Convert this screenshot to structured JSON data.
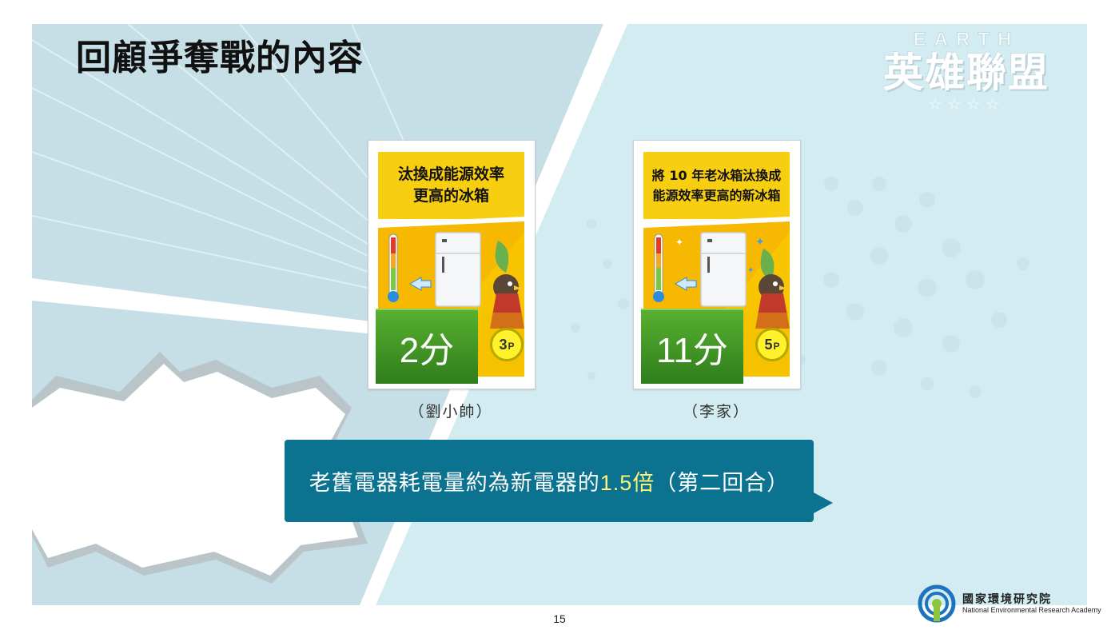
{
  "slide": {
    "title": "回顧爭奪戰的內容",
    "logo": {
      "top": "EARTH",
      "main": "英雄聯盟",
      "stars": "☆☆☆☆"
    }
  },
  "cards": [
    {
      "line1": "汰換成能源效率",
      "line2": "更高的冰箱",
      "score": "2分",
      "points": "3",
      "points_suffix": "P",
      "caption": "（劉小帥）"
    },
    {
      "line1": "將 10 年老冰箱汰換成",
      "line2": "能源效率更高的新冰箱",
      "score": "11分",
      "points": "5",
      "points_suffix": "P",
      "caption": "（李家）"
    }
  ],
  "bubble": {
    "text_before": "老舊電器耗電量約為新電器的",
    "highlight": "1.5倍",
    "text_after": "（第二回合）"
  },
  "footer": {
    "page_number": "15",
    "org_name": "國家環境研究院",
    "org_english": "National Environmental Research Academy"
  },
  "colors": {
    "bubble": "#0b7390",
    "highlight": "#fff27a",
    "card_header": "#f8cf10",
    "score_green": "#2f7d1c"
  }
}
